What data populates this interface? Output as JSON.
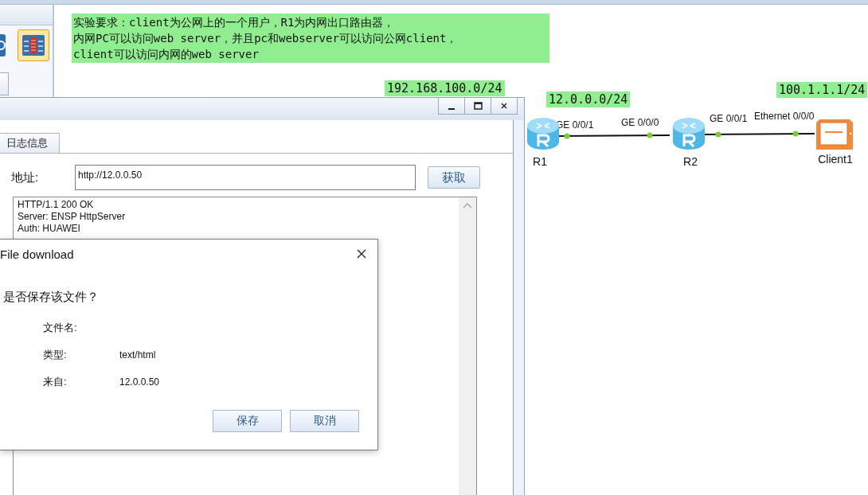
{
  "toolbar": {
    "items": [
      {
        "kind": "device",
        "selected": false
      },
      {
        "kind": "firewall",
        "selected": true
      }
    ]
  },
  "note": {
    "lines": [
      "实验要求：client为公网上的一个用户，R1为内网出口路由器，",
      "内网PC可以访问web server，并且pc和webserver可以访问公网client，",
      "client可以访问内网的web server"
    ]
  },
  "topology": {
    "subnets": [
      "192.168.100.0/24",
      "12.0.0.0/24",
      "100.1.1.1/24"
    ],
    "nodes": [
      {
        "kind": "router",
        "label": "R1"
      },
      {
        "kind": "router",
        "label": "R2"
      },
      {
        "kind": "client",
        "label": "Client1"
      }
    ],
    "links": [
      {
        "ports": [
          "GE 0/0/1",
          "GE 0/0/0"
        ]
      },
      {
        "ports": [
          "GE 0/0/1",
          "Ethernet 0/0/0"
        ]
      }
    ]
  },
  "client_window": {
    "tabs": [
      {
        "label": "日志信息",
        "selected": true
      }
    ],
    "address_label": "地址:",
    "address": "http://12.0.0.50",
    "fetch_button": "获取",
    "response_lines": [
      "HTTP/1.1 200 OK",
      "Server: ENSP HttpServer",
      "Auth: HUAWEI"
    ]
  },
  "dialog": {
    "title": "File download",
    "question": "是否保存该文件？",
    "fields": [
      {
        "label": "文件名:"
      },
      {
        "label": "类型:",
        "value": "text/html"
      },
      {
        "label": "来自:",
        "value": "12.0.0.50"
      }
    ],
    "buttons": [
      "保存",
      "取消"
    ]
  }
}
